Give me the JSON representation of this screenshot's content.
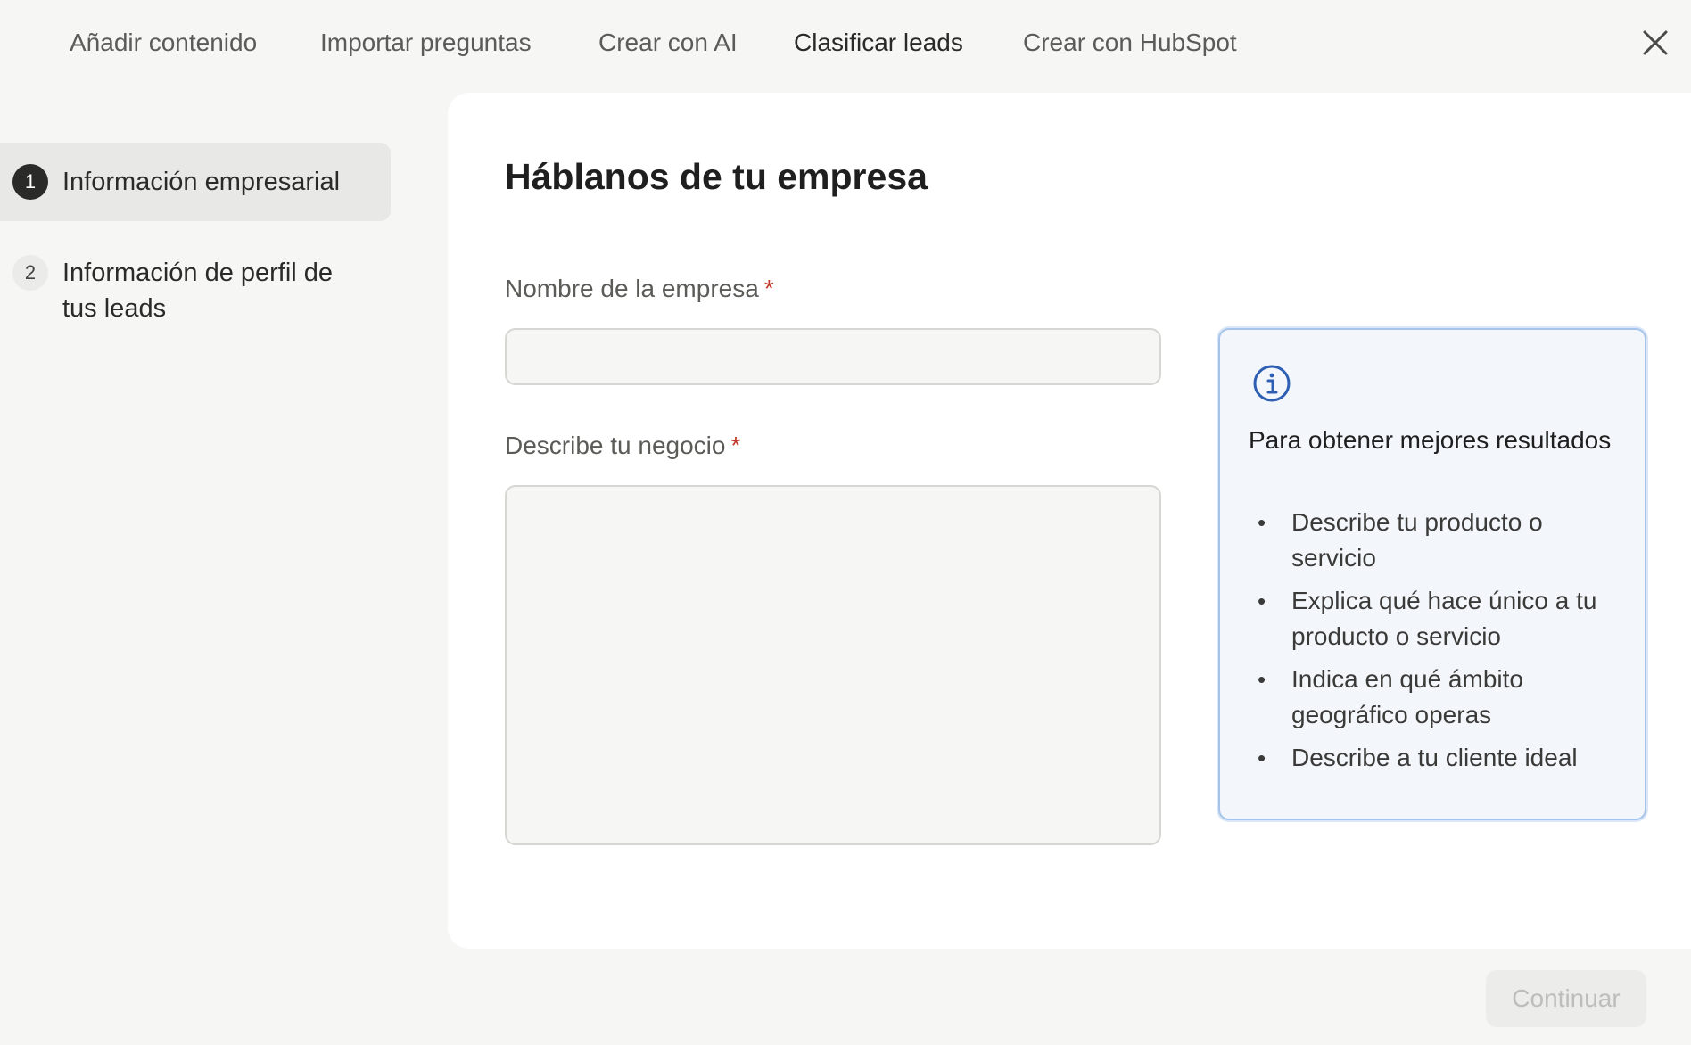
{
  "nav": {
    "tabs": [
      {
        "label": "Añadir contenido"
      },
      {
        "label": "Importar preguntas"
      },
      {
        "label": "Crear con AI"
      },
      {
        "label": "Clasificar leads"
      },
      {
        "label": "Crear con HubSpot"
      }
    ],
    "active_tab": "Clasificar leads",
    "close_icon": "close-icon"
  },
  "sidebar": {
    "steps": [
      {
        "number": "1",
        "label": "Información empresarial",
        "active": true
      },
      {
        "number": "2",
        "label": "Información de perfil de tus leads",
        "active": false
      }
    ]
  },
  "form": {
    "title": "Háblanos de tu empresa",
    "company_name": {
      "label": "Nombre de la empresa",
      "required_mark": "*",
      "value": "",
      "placeholder": ""
    },
    "business_description": {
      "label": "Describe tu negocio",
      "required_mark": "*",
      "value": "",
      "placeholder": ""
    }
  },
  "tips": {
    "icon": "info-icon",
    "title": "Para obtener mejores resultados",
    "items": [
      "Describe tu producto o servicio",
      "Explica qué hace único a tu producto o servicio",
      "Indica en qué ámbito geográfico operas",
      "Describe a tu cliente ideal"
    ]
  },
  "footer": {
    "continue_label": "Continuar",
    "continue_enabled": false
  },
  "colors": {
    "background": "#f6f6f4",
    "panel": "#ffffff",
    "required": "#c0392b",
    "info_accent": "#2f5fb3",
    "tips_border": "#a6c4ea"
  }
}
